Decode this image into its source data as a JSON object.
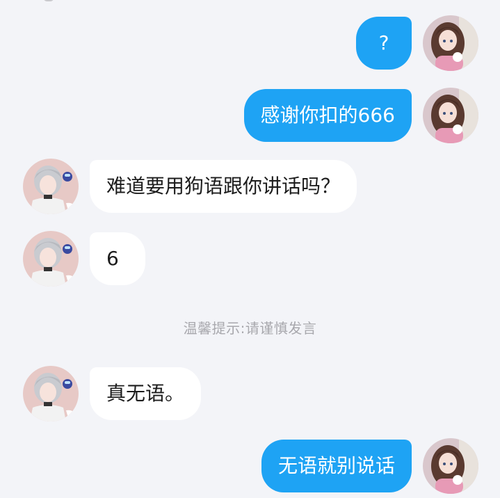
{
  "chat": {
    "notice": "温馨提示:请谨慎发言",
    "messages": [
      {
        "direction": "out",
        "text": "?",
        "avatar": "girl-avatar"
      },
      {
        "direction": "out",
        "text": "感谢你扣的666",
        "avatar": "girl-avatar"
      },
      {
        "direction": "in",
        "text": "难道要用狗语跟你讲话吗？",
        "avatar": "boy-avatar"
      },
      {
        "direction": "in",
        "text": "6",
        "avatar": "boy-avatar"
      },
      {
        "direction": "in",
        "text": "真无语。",
        "avatar": "boy-avatar"
      },
      {
        "direction": "out",
        "text": "无语就别说话",
        "avatar": "girl-avatar"
      }
    ]
  },
  "colors": {
    "background": "#f3f4f8",
    "outgoing_bubble": "#1ea3f4",
    "incoming_bubble": "#ffffff",
    "notice_text": "#a8a8ad"
  }
}
